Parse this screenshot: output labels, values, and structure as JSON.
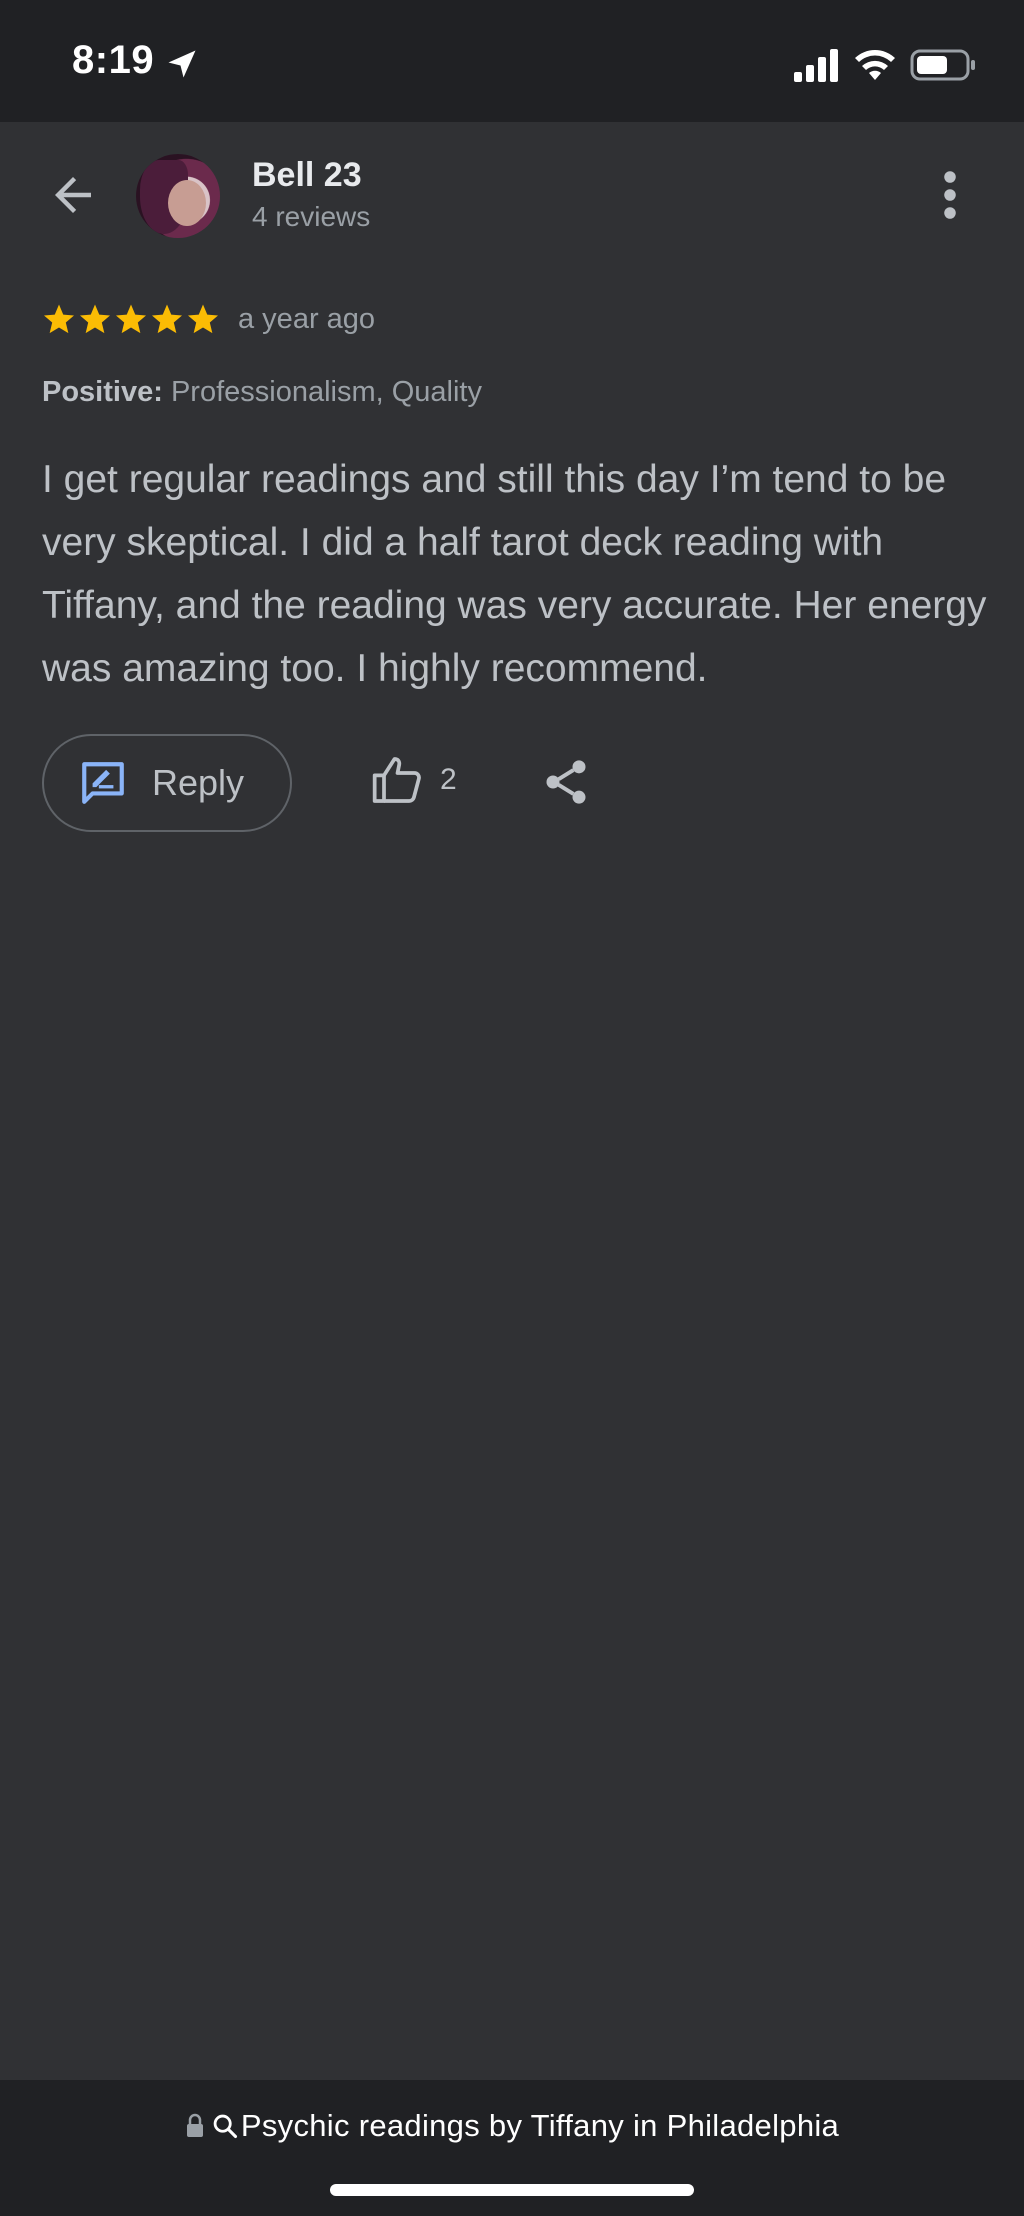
{
  "status_bar": {
    "time": "8:19",
    "icons": [
      "location-arrow-icon",
      "cellular-signal-icon",
      "wifi-icon",
      "battery-icon"
    ]
  },
  "header": {
    "back_icon": "arrow-left-icon",
    "reviewer_name": "Bell 23",
    "reviewer_reviews": "4 reviews",
    "more_icon": "more-vertical-icon"
  },
  "review": {
    "rating": 5,
    "max_rating": 5,
    "star_color": "#fbbc04",
    "time": "a year ago",
    "tags_label": "Positive:",
    "tags_value": "Professionalism, Quality",
    "text": "I get regular readings and still this day I’m tend to be very skeptical. I did a half tarot deck reading with Tiffany, and the reading was very accurate. Her energy was amazing too. I highly recommend."
  },
  "actions": {
    "reply_label": "Reply",
    "reply_icon_color": "#8ab4f8",
    "like_count": "2"
  },
  "browser_bar": {
    "url_text": "Psychic readings by Tiffany in Philadelphia"
  },
  "colors": {
    "background": "#303134",
    "bars": "#202124",
    "text_primary": "#e8eaed",
    "text_secondary": "#9aa0a6"
  }
}
